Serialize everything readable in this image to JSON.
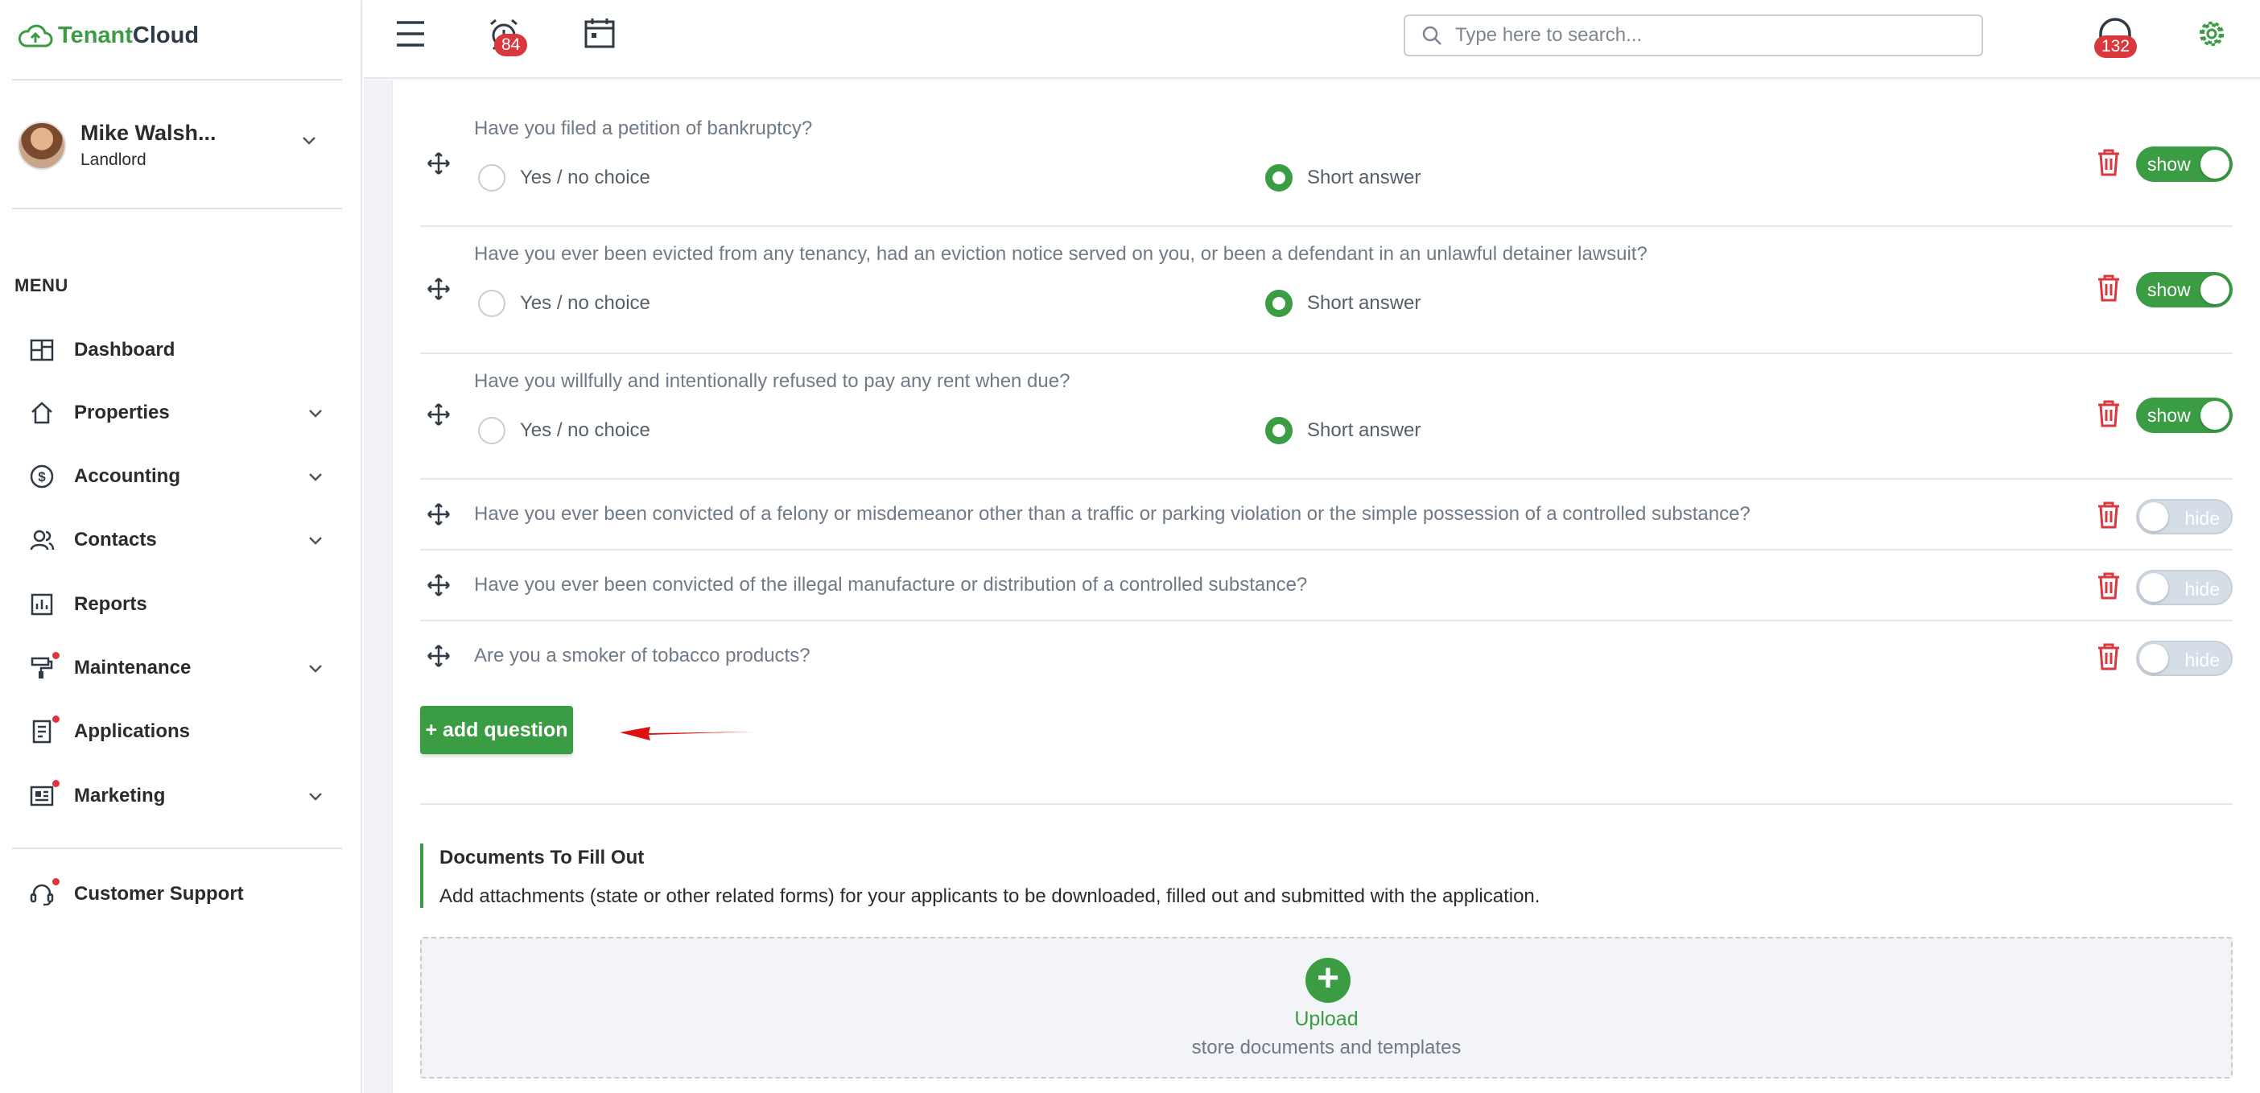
{
  "brand": {
    "name_part1": "Tenant",
    "name_part2": "Cloud"
  },
  "user": {
    "name": "Mike Walsh...",
    "role": "Landlord"
  },
  "menu": {
    "title": "MENU",
    "items": [
      {
        "label": "Dashboard",
        "icon": "dashboard-icon",
        "has_chevron": false,
        "has_dot": false
      },
      {
        "label": "Properties",
        "icon": "home-icon",
        "has_chevron": true,
        "has_dot": false
      },
      {
        "label": "Accounting",
        "icon": "dollar-icon",
        "has_chevron": true,
        "has_dot": false
      },
      {
        "label": "Contacts",
        "icon": "contacts-icon",
        "has_chevron": true,
        "has_dot": false
      },
      {
        "label": "Reports",
        "icon": "reports-icon",
        "has_chevron": false,
        "has_dot": false
      },
      {
        "label": "Maintenance",
        "icon": "paint-roller-icon",
        "has_chevron": true,
        "has_dot": true
      },
      {
        "label": "Applications",
        "icon": "document-icon",
        "has_chevron": false,
        "has_dot": true
      },
      {
        "label": "Marketing",
        "icon": "newspaper-icon",
        "has_chevron": true,
        "has_dot": true
      }
    ],
    "support": {
      "label": "Customer Support",
      "icon": "headset-icon"
    }
  },
  "topbar": {
    "alarm_badge": "84",
    "support_badge": "132",
    "search_placeholder": "Type here to search..."
  },
  "questions": [
    {
      "text": "Have you filed a petition of bankruptcy?",
      "options": [
        "Yes / no choice",
        "Short answer"
      ],
      "selected": 1,
      "toggle": "show"
    },
    {
      "text": "Have you ever been evicted from any tenancy, had an eviction notice served on you, or been a defendant in an unlawful detainer lawsuit?",
      "options": [
        "Yes / no choice",
        "Short answer"
      ],
      "selected": 1,
      "toggle": "show"
    },
    {
      "text": "Have you willfully and intentionally refused to pay any rent when due?",
      "options": [
        "Yes / no choice",
        "Short answer"
      ],
      "selected": 1,
      "toggle": "show"
    },
    {
      "text": "Have you ever been convicted of a felony or misdemeanor other than a traffic or parking violation or the simple possession of a controlled substance?",
      "toggle": "hide"
    },
    {
      "text": "Have you ever been convicted of the illegal manufacture or distribution of a controlled substance?",
      "toggle": "hide"
    },
    {
      "text": "Are you a smoker of tobacco products?",
      "toggle": "hide"
    }
  ],
  "add_question_label": "+ add question",
  "documents": {
    "title": "Documents To Fill Out",
    "description": "Add attachments (state or other related forms) for your applicants to be downloaded, filled out and submitted with the application."
  },
  "upload": {
    "label": "Upload",
    "sublabel": "store documents and templates"
  },
  "colors": {
    "brand_green": "#3a9c43",
    "danger_red": "#d9383d",
    "toggle_off": "#d5dde7"
  }
}
